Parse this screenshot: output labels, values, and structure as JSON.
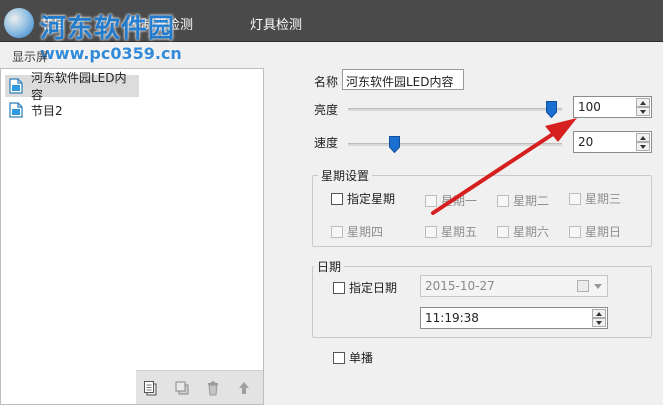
{
  "tabs": [
    "节目",
    "控制器检测",
    "灯具检测"
  ],
  "watermark": {
    "title": "河东软件园",
    "url": "www.pc0359.cn"
  },
  "display_label": "显示屏",
  "programs": [
    {
      "label": "河东软件园LED内容",
      "selected": true
    },
    {
      "label": "节目2",
      "selected": false
    }
  ],
  "toolbar_icons": [
    "copy-icon",
    "duplicate-icon",
    "delete-icon",
    "move-up-icon"
  ],
  "form": {
    "name_label": "名称",
    "name_value": "河东软件园LED内容",
    "brightness_label": "亮度",
    "brightness_value": "100",
    "brightness_level": 1.0,
    "speed_label": "速度",
    "speed_value": "20",
    "speed_level": 0.2,
    "week_group_title": "星期设置",
    "specify_week_label": "指定星期",
    "weekdays": [
      "星期一",
      "星期二",
      "星期三",
      "星期四",
      "星期五",
      "星期六",
      "星期日"
    ],
    "date_group_title": "日期",
    "specify_date_label": "指定日期",
    "date_value": "2015-10-27",
    "time_value": "11:19:38",
    "single_play_label": "单播"
  },
  "colors": {
    "tab_bar": "#4a4a4a",
    "slider_thumb": "#1a6fd0",
    "annotation_arrow": "#d62020",
    "watermark": "#1e7fd6"
  }
}
